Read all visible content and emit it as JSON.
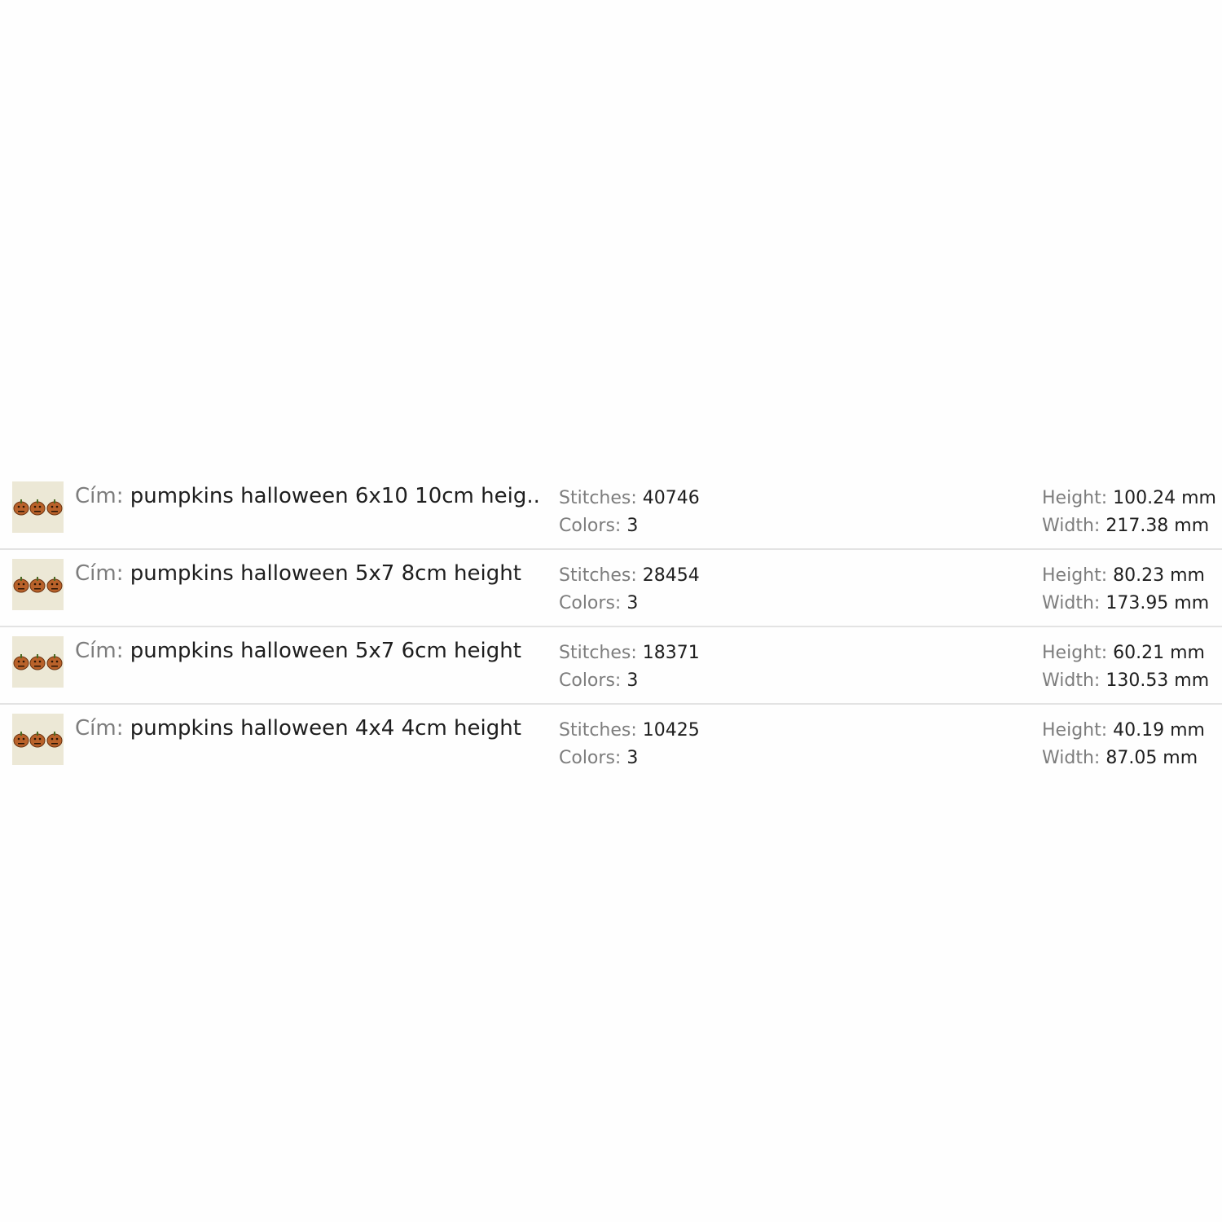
{
  "labels": {
    "title": "Cím:",
    "stitches": "Stitches:",
    "colors": "Colors:",
    "height": "Height:",
    "width": "Width:"
  },
  "thumbnail": {
    "icon": "pumpkins-thumbnail-icon",
    "background": "#ece8d6",
    "pumpkin_color": "#b9622a"
  },
  "rows": [
    {
      "title": "pumpkins halloween 6x10 10cm heig...",
      "stitches": "40746",
      "colors": "3",
      "height": "100.24 mm",
      "width": "217.38 mm"
    },
    {
      "title": "pumpkins halloween 5x7 8cm height",
      "stitches": "28454",
      "colors": "3",
      "height": "80.23 mm",
      "width": "173.95 mm"
    },
    {
      "title": "pumpkins halloween 5x7 6cm height",
      "stitches": "18371",
      "colors": "3",
      "height": "60.21 mm",
      "width": "130.53 mm"
    },
    {
      "title": "pumpkins halloween 4x4 4cm height",
      "stitches": "10425",
      "colors": "3",
      "height": "40.19 mm",
      "width": "87.05 mm"
    }
  ]
}
